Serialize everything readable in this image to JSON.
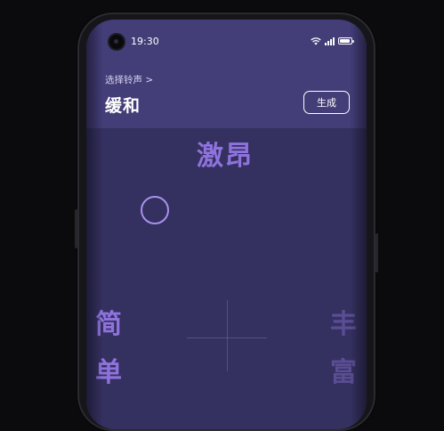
{
  "status_bar": {
    "time": "19:30",
    "signal_bars": 4,
    "battery_level": 0.9
  },
  "header": {
    "breadcrumb": "选择铃声 >",
    "title": "缓和",
    "generate_label": "生成"
  },
  "mood_pad": {
    "top_label": "激昂",
    "left_label": "简单",
    "right_label": "丰富"
  },
  "colors": {
    "screen_background": "#34305f",
    "header_background": "#433d78",
    "axis_label": "#8f73dd",
    "selector_ring": "#a891ea"
  }
}
